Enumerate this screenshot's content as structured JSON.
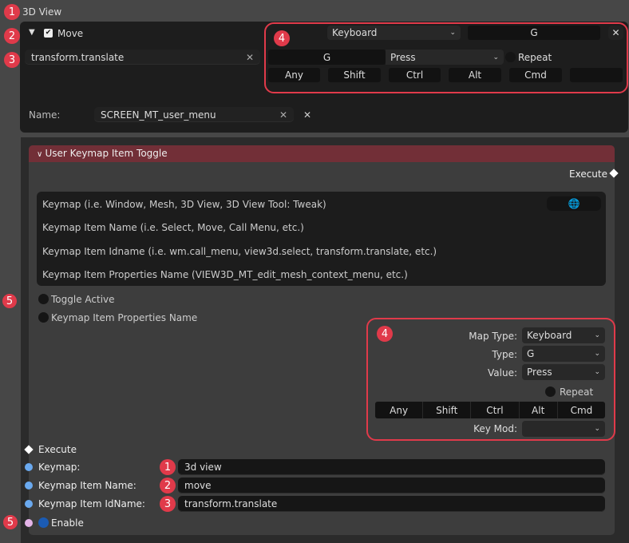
{
  "top": {
    "keymap": "3D View",
    "item_name": "Move",
    "item_checked": true,
    "idname": "transform.translate",
    "name_label": "Name:",
    "name_value": "SCREEN_MT_user_menu",
    "map_type": "Keyboard",
    "key_display": "G",
    "type": "G",
    "value": "Press",
    "repeat_label": "Repeat",
    "modifiers": [
      "Any",
      "Shift",
      "Ctrl",
      "Alt",
      "Cmd",
      ""
    ]
  },
  "node": {
    "title": "User Keymap Item Toggle",
    "execute_out": "Execute",
    "info_lines": [
      "Keymap (i.e. Window, Mesh, 3D View, 3D View Tool: Tweak)",
      "Keymap Item Name (i.e. Select, Move, Call Menu, etc.)",
      "Keymap Item Idname (i.e. wm.call_menu, view3d.select, transform.translate, etc.)",
      "Keymap Item Properties Name (VIEW3D_MT_edit_mesh_context_menu, etc.)"
    ],
    "toggle_active": "Toggle Active",
    "props_name": "Keymap Item Properties Name",
    "map_type_label": "Map Type:",
    "map_type": "Keyboard",
    "type_label": "Type:",
    "type": "G",
    "value_label": "Value:",
    "value": "Press",
    "repeat_label": "Repeat",
    "modifiers": [
      "Any",
      "Shift",
      "Ctrl",
      "Alt",
      "Cmd"
    ],
    "key_mod_label": "Key Mod:",
    "key_mod": "",
    "execute_in": "Execute",
    "inputs": [
      {
        "label": "Keymap:",
        "value": "3d view",
        "badge": "1"
      },
      {
        "label": "Keymap Item Name:",
        "value": "move",
        "badge": "2"
      },
      {
        "label": "Keymap Item IdName:",
        "value": "transform.translate",
        "badge": "3"
      }
    ],
    "enable_label": "Enable"
  },
  "badges": {
    "one": "1",
    "two": "2",
    "three": "3",
    "four": "4",
    "five": "5"
  },
  "colors": {
    "accent_red": "#e03a4a",
    "header": "#722f37",
    "socket_blue": "#6aa9ef",
    "socket_pink": "#e4b4e8"
  }
}
